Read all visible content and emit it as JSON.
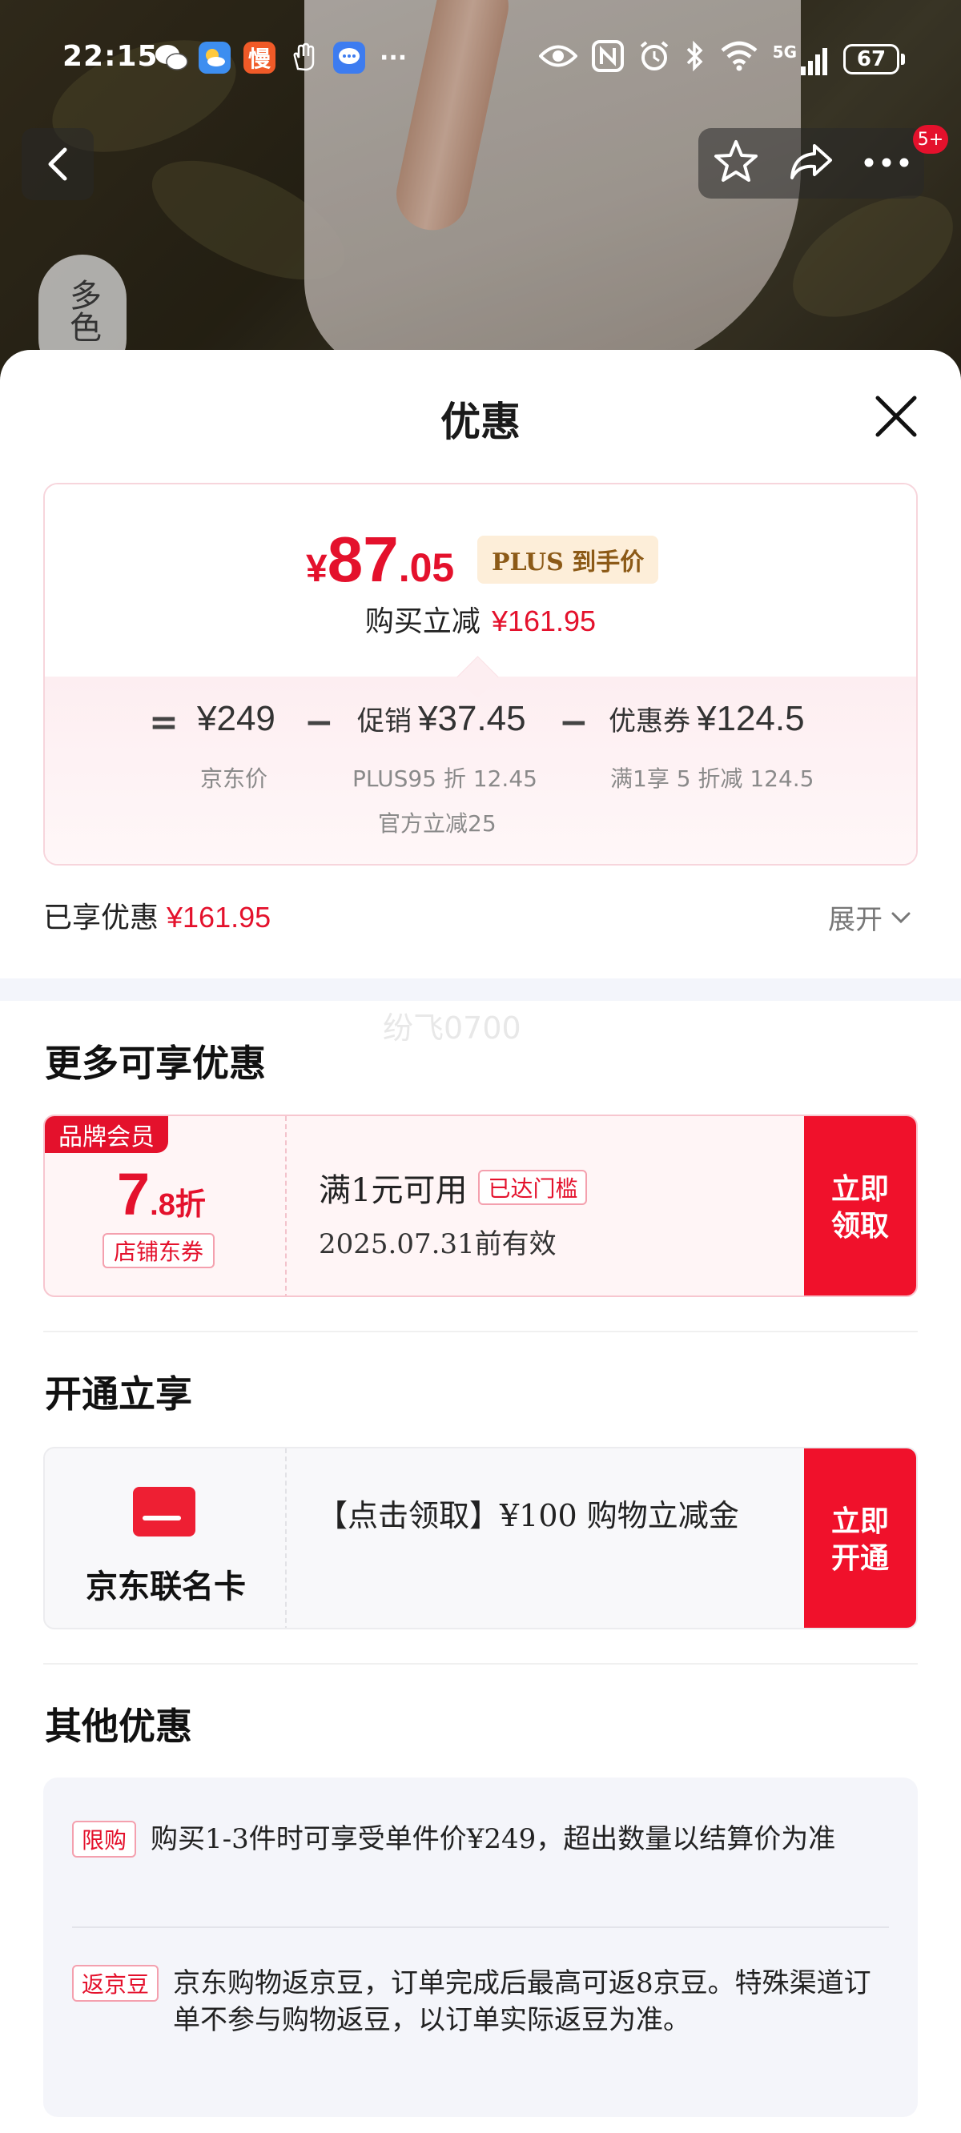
{
  "status_bar": {
    "time": "22:15",
    "network": "5G",
    "battery": "67"
  },
  "header": {
    "more_badge": "5+",
    "side_tab": "多色"
  },
  "sheet": {
    "title": "优惠",
    "summary": {
      "currency": "¥",
      "price_int": "87",
      "price_dec": ".05",
      "price_tag": "PLUS 到手价",
      "reduce_label": "购买立减",
      "reduce_value": "¥161.95",
      "formula": {
        "equals": "=",
        "minus": "−",
        "jd_price": "¥249",
        "jd_price_label": "京东价",
        "promo_label": "促销",
        "promo_value": "¥37.45",
        "promo_note_1": "PLUS95 折 12.45",
        "promo_note_2": "官方立减25",
        "coupon_label": "优惠券",
        "coupon_value": "¥124.5",
        "coupon_note": "满1享 5 折减 124.5"
      }
    },
    "enjoyed_label": "已享优惠",
    "enjoyed_value": "¥161.95",
    "expand_label": "展开",
    "watermark": "纷飞0700"
  },
  "more_offers": {
    "title": "更多可享优惠",
    "coupon": {
      "ribbon": "品牌会员",
      "discount_int": "7",
      "discount_dec": ".8折",
      "type_tag": "店铺东券",
      "condition": "满1元可用",
      "reached_tag": "已达门槛",
      "validity": "2025.07.31前有效",
      "button_line1": "立即",
      "button_line2": "领取"
    }
  },
  "activate": {
    "title": "开通立享",
    "card_name": "京东联名卡",
    "offer_text": "【点击领取】¥100 购物立减金",
    "button_line1": "立即",
    "button_line2": "开通"
  },
  "other_offers": {
    "title": "其他优惠",
    "items": [
      {
        "tag": "限购",
        "text": "购买1-3件时可享受单件价¥249，超出数量以结算价为准"
      },
      {
        "tag": "返京豆",
        "text": "京东购物返京豆，订单完成后最高可返8京豆。特殊渠道订单不参与购物返豆，以订单实际返豆为准。"
      }
    ]
  },
  "colors": {
    "accent": "#e4112c",
    "button": "#f0112b",
    "plus_tag_bg": "#fdeed9",
    "plus_tag_text": "#8c5a17"
  }
}
